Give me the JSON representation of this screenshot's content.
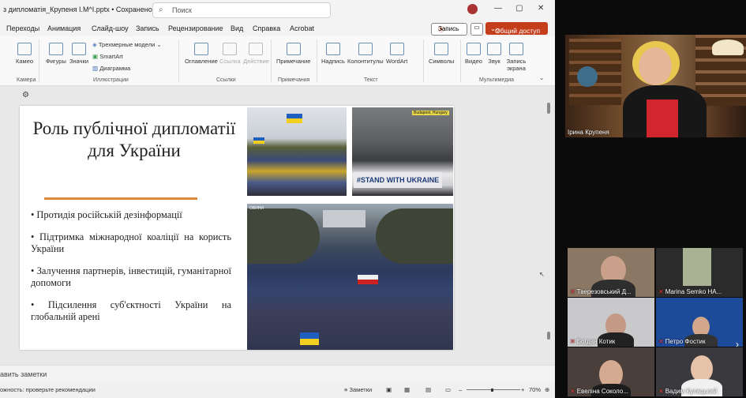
{
  "titlebar": {
    "document": "з дипломатія_Крупеня І.М^І.pptx • Сохранено ⌄",
    "search_placeholder": "Поиск"
  },
  "menu": {
    "tabs": [
      "Переходы",
      "Анимация",
      "Слайд-шоу",
      "Запись",
      "Рецензирование",
      "Вид",
      "Справка",
      "Acrobat"
    ],
    "record_label": "Запись",
    "share_label": "Общий доступ"
  },
  "ribbon": {
    "camera": "Камео",
    "camera_group": "Камера",
    "shapes": "Фигуры",
    "icons": "Значки",
    "models3d": "Трехмерные модели",
    "smartart": "SmartArt",
    "diagram": "Диаграмма",
    "illustrations_group": "Иллюстрации",
    "zoom": "Оглавление",
    "link": "Ссылка",
    "action": "Действие",
    "links_group": "Ссылки",
    "comment": "Примечание",
    "comments_group": "Примечания",
    "textbox": "Надпись",
    "header_footer": "Колонтитулы",
    "wordart": "WordArt",
    "text_group": "Текст",
    "symbols": "Символы",
    "video": "Видео",
    "audio": "Звук",
    "screen_record": "Запись экрана",
    "media_group": "Мультимедиа"
  },
  "slide": {
    "title": "Роль публічної дипломатії для України",
    "bullets": [
      "• Протидія російській дезінформації",
      "• Підтримка міжнародної коаліції на користь України",
      "• Залучення партнерів, інвестицій, гуманітарної допомоги",
      "• Підсилення суб'єктності України на глобальній арені"
    ],
    "photo2_caption": "Budapest, Hungary",
    "photo2_banner": "#STAND WITH UKRAINE",
    "photo3_caption": "ОВИНИ"
  },
  "notes_placeholder": "авить заметки",
  "status": {
    "accessibility": "ожность: проверьте рекомендации",
    "notes_btn": "Заметки",
    "zoom": "70%"
  },
  "participants": [
    {
      "name": "Ірина Крупеня"
    },
    {
      "name": "Тверезовський Д..."
    },
    {
      "name": "Marina Semko НА..."
    },
    {
      "name": "Богдан Котик"
    },
    {
      "name": "Петро Фостик"
    },
    {
      "name": "Евеліна Соколо..."
    },
    {
      "name": "Вадим Кулацький"
    }
  ],
  "colors": {
    "accent_red": "#c43e1c",
    "underline": "#d98a3a",
    "ukraine_blue": "#1f5fbf",
    "ukraine_yellow": "#f2cf1d"
  }
}
